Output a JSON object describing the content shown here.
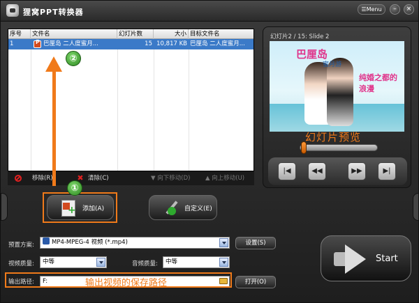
{
  "window": {
    "title": "狸窝PPT转换器",
    "menu_label": "Menu",
    "minimize_label": "–",
    "close_label": "×"
  },
  "file_table": {
    "columns": [
      "序号",
      "文件名",
      "幻灯片数",
      "大小",
      "目标文件名"
    ],
    "rows": [
      {
        "index": "1",
        "filename": "巴厘岛 二人度蜜月...",
        "slides": "15",
        "size": "10,817 KB",
        "target": "巴厘岛 二人度蜜月..."
      }
    ]
  },
  "list_toolbar": {
    "remove": "移除(R)",
    "clear": "清除(C)",
    "move_down": "向下移动(D)",
    "move_up": "向上移动(U)"
  },
  "actions": {
    "add": "添加(A)",
    "custom": "自定义(E)"
  },
  "preview": {
    "slide_label": "幻灯片2 / 15: Slide 2",
    "slide_title": "巴厘岛",
    "slide_subtitle": "蜜月游",
    "slide_caption": "纯婚之都的浪漫",
    "annotation": "幻灯片预览",
    "seek_fraction": 0.02
  },
  "controls": {
    "skip_back": "|◀",
    "rewind": "◀◀",
    "fast_forward": "▶▶",
    "skip_forward": "▶|"
  },
  "settings": {
    "preset_label": "预置方案:",
    "preset_value": "MP4-MPEG-4 视频 (*.mp4)",
    "settings_button": "设置(S)",
    "video_quality_label": "视频质量:",
    "video_quality_value": "中等",
    "audio_quality_label": "音频质量:",
    "audio_quality_value": "中等",
    "output_path_label": "输出路径:",
    "output_path_value": "F:",
    "output_path_annotation": "输出视频的保存路径",
    "open_button": "打开(O)",
    "start_button": "Start"
  },
  "annotations": {
    "marker_1": "①",
    "marker_2": "②"
  },
  "colors": {
    "accent": "#f07a1a",
    "selection": "#3b7ac8"
  }
}
